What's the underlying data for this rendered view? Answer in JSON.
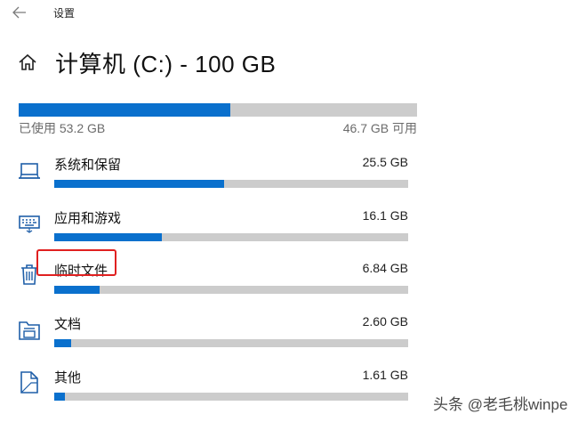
{
  "window": {
    "title": "设置"
  },
  "header": {
    "title": "计算机 (C:) - 100 GB"
  },
  "storage": {
    "used_label": "已使用 53.2 GB",
    "free_label": "46.7 GB 可用",
    "used_fraction": 0.532
  },
  "categories": [
    {
      "name": "系统和保留",
      "size": "25.5 GB",
      "fraction": 0.48,
      "icon": "laptop-icon"
    },
    {
      "name": "应用和游戏",
      "size": "16.1 GB",
      "fraction": 0.305,
      "icon": "keyboard-icon"
    },
    {
      "name": "临时文件",
      "size": "6.84 GB",
      "fraction": 0.128,
      "icon": "trash-icon"
    },
    {
      "name": "文档",
      "size": "2.60 GB",
      "fraction": 0.048,
      "icon": "folder-icon"
    },
    {
      "name": "其他",
      "size": "1.61 GB",
      "fraction": 0.03,
      "icon": "file-icon"
    }
  ],
  "watermark": "头条 @老毛桃winpe",
  "colors": {
    "accent": "#0a70cd",
    "track": "#cccccc",
    "highlight": "#e02020"
  }
}
